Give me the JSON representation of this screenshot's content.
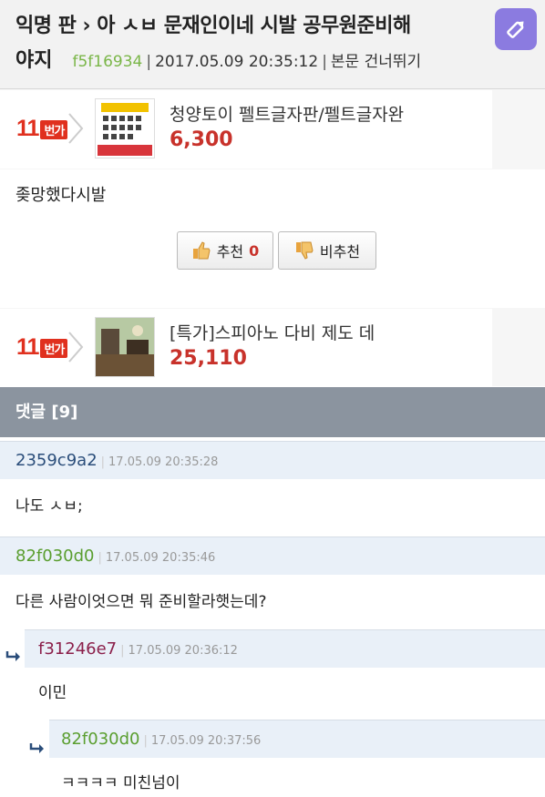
{
  "post": {
    "title_line1": "익명 판 › 아 ㅅㅂ 문재인이네 시발 공무원준비해",
    "title_line2": "야지",
    "author_id": "f5f16934",
    "date": "2017.05.09 20:35:12",
    "skip_label": "본문 건너뛰기",
    "body": "좆망했다시발",
    "upvote_label": "추천",
    "upvote_count": "0",
    "downvote_label": "비추천"
  },
  "ads": [
    {
      "logo": "11",
      "tag": "번가",
      "name": "청양토이 펠트글자판/펠트글자완",
      "price": "6,300"
    },
    {
      "logo": "11",
      "tag": "번가",
      "name": "[특가]스피아노 다비 제도 데",
      "price": "25,110"
    }
  ],
  "comments_header": "댓글 [9]",
  "comments": [
    {
      "id": "2359c9a2",
      "date": "17.05.09 20:35:28",
      "text": "나도 ㅅㅂ;",
      "color": "#2a4d7a"
    },
    {
      "id": "82f030d0",
      "date": "17.05.09 20:35:46",
      "text": "다른 사람이엇으면 뭐 준비할라햇는데?",
      "color": "#5a9e2f"
    },
    {
      "id": "f31246e7",
      "date": "17.05.09 20:36:12",
      "text": "이민",
      "color": "#8b1f4a"
    },
    {
      "id": "82f030d0",
      "date": "17.05.09 20:37:56",
      "text": "ㅋㅋㅋㅋ 미친넘이",
      "color": "#5a9e2f"
    }
  ],
  "colors": {
    "header_bg": "#f2f2f2",
    "accent": "#8b7be0",
    "price": "#c8322b",
    "comments_bar": "#8b949f"
  },
  "icons": [
    "pencil-icon",
    "thumbs-up-icon",
    "thumbs-down-icon",
    "reply-arrow-icon",
    "chevron-right-icon"
  ]
}
